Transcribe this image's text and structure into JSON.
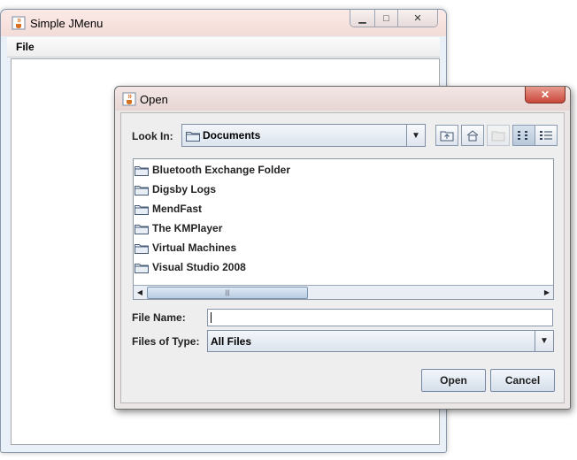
{
  "main_window": {
    "title": "Simple JMenu",
    "menu": {
      "file_label": "File"
    }
  },
  "open_dialog": {
    "title": "Open",
    "look_in_label": "Look In:",
    "look_in_value": "Documents",
    "files": [
      {
        "name": "Bluetooth Exchange Folder"
      },
      {
        "name": "Digsby Logs"
      },
      {
        "name": "MendFast"
      },
      {
        "name": "The KMPlayer"
      },
      {
        "name": "Virtual Machines"
      },
      {
        "name": "Visual Studio 2008"
      }
    ],
    "file_name_label": "File Name:",
    "file_name_value": "",
    "files_of_type_label": "Files of Type:",
    "files_of_type_value": "All Files",
    "open_button": "Open",
    "cancel_button": "Cancel",
    "icons": {
      "app": "java-cup-icon",
      "up_folder": "up-folder-icon",
      "home": "home-icon",
      "new_folder": "new-folder-icon",
      "list_view": "list-view-icon",
      "details_view": "details-view-icon",
      "folder": "folder-icon"
    },
    "colors": {
      "close_button": "#c9473a",
      "title_bar": "#f3e6e4"
    }
  }
}
